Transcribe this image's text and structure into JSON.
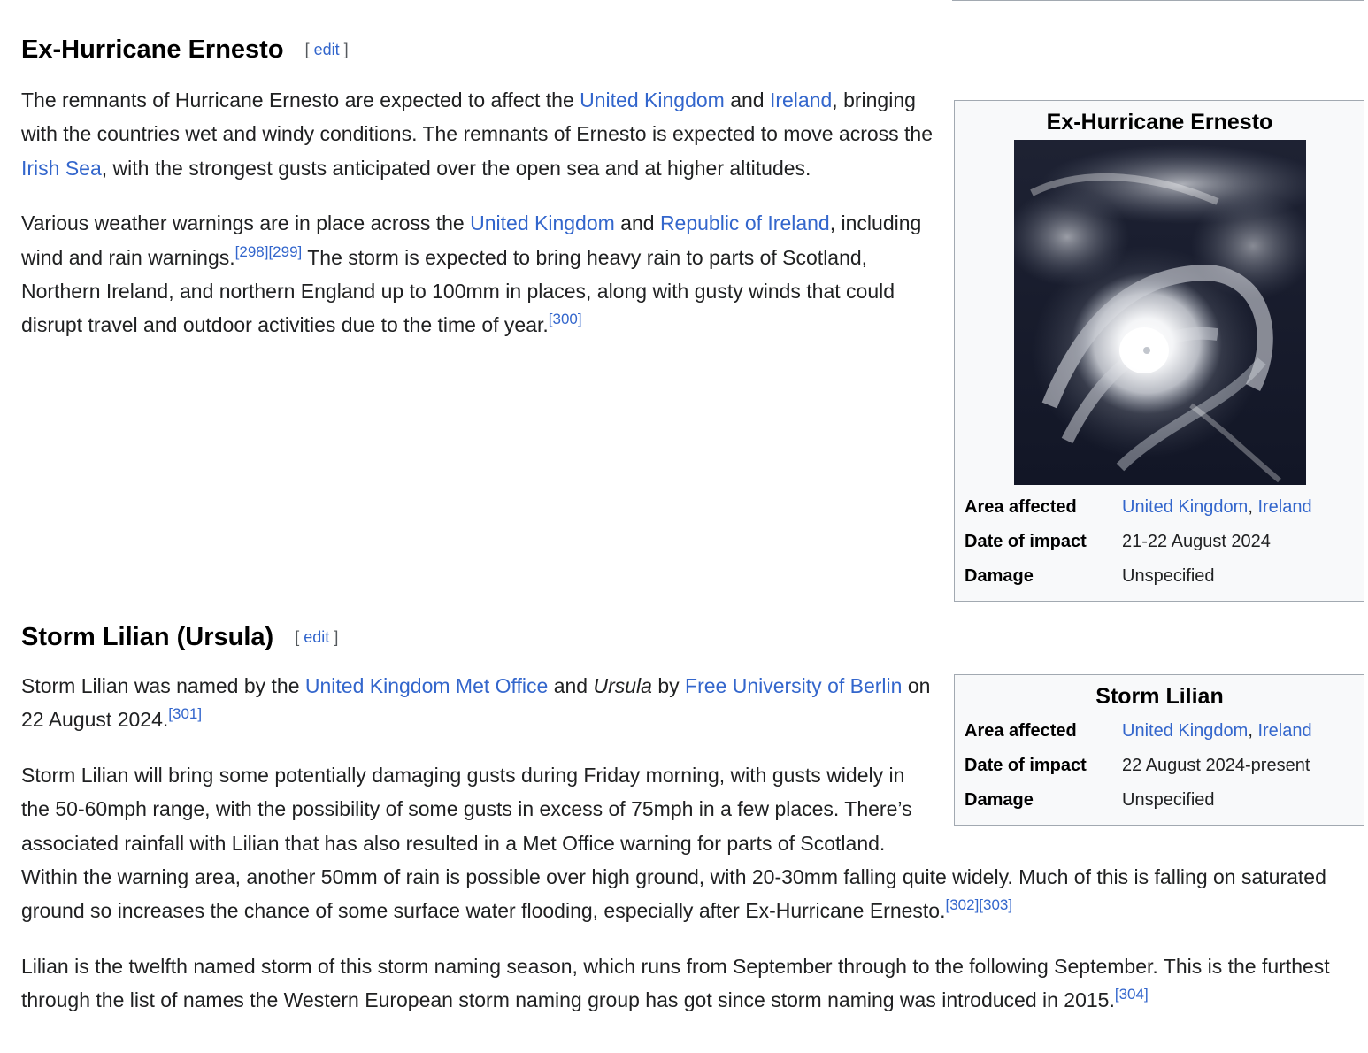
{
  "sections": {
    "ernesto": {
      "title": "Ex-Hurricane Ernesto",
      "edit_label": "edit",
      "p1": {
        "t1": "The remnants of Hurricane Ernesto are expected to affect the ",
        "link_uk": "United Kingdom",
        "t2": " and ",
        "link_ireland": "Ireland",
        "t3": ", bringing with the countries wet and windy conditions. The remnants of Ernesto is expected to move across the ",
        "link_irish_sea": "Irish Sea",
        "t4": ", with the strongest gusts anticipated over the open sea and at higher altitudes."
      },
      "p2": {
        "t1": "Various weather warnings are in place across the ",
        "link_uk": "United Kingdom",
        "t2": " and ",
        "link_roi": "Republic of Ireland",
        "t3": ", including wind and rain warnings.",
        "ref1": "[298]",
        "ref2": "[299]",
        "t4": " The storm is expected to bring heavy rain to parts of Scotland, Northern Ireland, and northern England up to 100mm in places, along with gusty winds that could disrupt travel and outdoor activities due to the time of year.",
        "ref3": "[300]"
      },
      "infobox": {
        "title": "Ex-Hurricane Ernesto",
        "area_label": "Area affected",
        "area_link1": "United Kingdom",
        "area_sep": ", ",
        "area_link2": "Ireland",
        "date_label": "Date of impact",
        "date_value": "21-22 August 2024",
        "damage_label": "Damage",
        "damage_value": "Unspecified"
      }
    },
    "lilian": {
      "title": "Storm Lilian (Ursula)",
      "edit_label": "edit",
      "p1": {
        "t1": "Storm Lilian was named by the ",
        "link_met": "United Kingdom Met Office",
        "t2": " and ",
        "ursula": "Ursula",
        "t3": " by ",
        "link_fu": "Free University of Berlin",
        "t4": " on 22 August 2024.",
        "ref1": "[301]"
      },
      "p2": {
        "text": "Storm Lilian will bring some potentially damaging gusts during Friday morning, with gusts widely in the 50-60mph range, with the possibility of some gusts in excess of 75mph in a few places. There’s associated rainfall with Lilian that has also resulted in a Met Office warning for parts of Scotland. Within the warning area, another 50mm of rain is possible over high ground, with 20-30mm falling quite widely. Much of this is falling on saturated ground so increases the chance of some surface water flooding, especially after Ex-Hurricane Ernesto.",
        "ref1": "[302]",
        "ref2": "[303]"
      },
      "p3": {
        "text": "Lilian is the twelfth named storm of this storm naming season, which runs from September through to the following September. This is the furthest through the list of names the Western European storm naming group has got since storm naming was introduced in 2015.",
        "ref1": "[304]"
      },
      "infobox": {
        "title": "Storm Lilian",
        "area_label": "Area affected",
        "area_link1": "United Kingdom",
        "area_sep": ", ",
        "area_link2": "Ireland",
        "date_label": "Date of impact",
        "date_value": "22 August 2024-present",
        "damage_label": "Damage",
        "damage_value": "Unspecified"
      }
    }
  }
}
